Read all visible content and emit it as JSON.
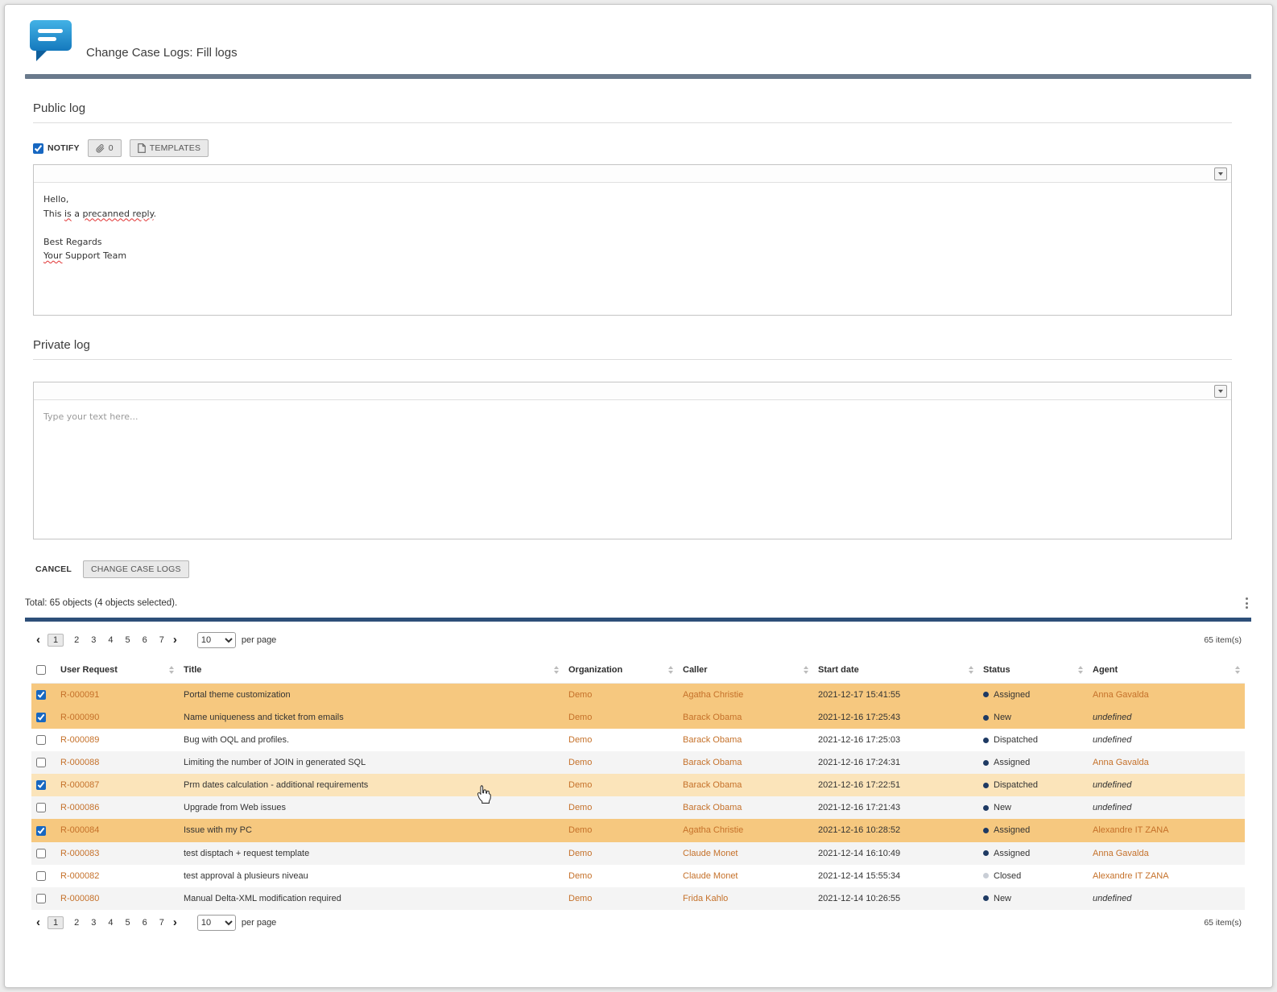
{
  "window": {
    "title": "Change Case Logs: Fill logs"
  },
  "public_log": {
    "heading": "Public log",
    "notify_label": "NOTIFY",
    "attach_count": "0",
    "templates_label": "TEMPLATES",
    "lines": [
      "Hello,",
      [
        {
          "t": "This "
        },
        {
          "t": "is",
          "m": true
        },
        {
          "t": " a "
        },
        {
          "t": "precanned reply",
          "m": true
        },
        {
          "t": "."
        }
      ],
      "",
      "Best Regards",
      [
        {
          "t": "Your",
          "m": true
        },
        {
          "t": " Support Team"
        }
      ]
    ]
  },
  "private_log": {
    "heading": "Private log",
    "placeholder": "Type your text here..."
  },
  "actions": {
    "cancel": "CANCEL",
    "submit": "CHANGE CASE LOGS"
  },
  "results": {
    "summary": "Total: 65 objects (4 objects selected).",
    "items_count": "65 item(s)",
    "per_page_value": "10",
    "per_page_label": "per page",
    "current_page": "1",
    "pages": [
      "1",
      "2",
      "3",
      "4",
      "5",
      "6",
      "7"
    ],
    "prev_arrow": "‹",
    "next_arrow": "›",
    "columns": [
      "User Request",
      "Title",
      "Organization",
      "Caller",
      "Start date",
      "Status",
      "Agent"
    ],
    "rows": [
      {
        "id": "R-000091",
        "title": "Portal theme customization",
        "org": "Demo",
        "caller": "Agatha Christie",
        "start": "2021-12-17 15:41:55",
        "status": "Assigned",
        "agent": "Anna Gavalda",
        "selected": true
      },
      {
        "id": "R-000090",
        "title": "Name uniqueness and ticket from emails",
        "org": "Demo",
        "caller": "Barack Obama",
        "start": "2021-12-16 17:25:43",
        "status": "New",
        "agent": "undefined",
        "selected": true
      },
      {
        "id": "R-000089",
        "title": "Bug with OQL and profiles.",
        "org": "Demo",
        "caller": "Barack Obama",
        "start": "2021-12-16 17:25:03",
        "status": "Dispatched",
        "agent": "undefined",
        "selected": false
      },
      {
        "id": "R-000088",
        "title": "Limiting the number of JOIN in generated SQL",
        "org": "Demo",
        "caller": "Barack Obama",
        "start": "2021-12-16 17:24:31",
        "status": "Assigned",
        "agent": "Anna Gavalda",
        "selected": false
      },
      {
        "id": "R-000087",
        "title": "Prm dates calculation - additional requirements",
        "org": "Demo",
        "caller": "Barack Obama",
        "start": "2021-12-16 17:22:51",
        "status": "Dispatched",
        "agent": "undefined",
        "selected": true,
        "hovered": true
      },
      {
        "id": "R-000086",
        "title": "Upgrade from Web issues",
        "org": "Demo",
        "caller": "Barack Obama",
        "start": "2021-12-16 17:21:43",
        "status": "New",
        "agent": "undefined",
        "selected": false
      },
      {
        "id": "R-000084",
        "title": "Issue with my PC",
        "org": "Demo",
        "caller": "Agatha Christie",
        "start": "2021-12-16 10:28:52",
        "status": "Assigned",
        "agent": "Alexandre IT ZANA",
        "selected": true
      },
      {
        "id": "R-000083",
        "title": "test disptach + request template",
        "org": "Demo",
        "caller": "Claude Monet",
        "start": "2021-12-14 16:10:49",
        "status": "Assigned",
        "agent": "Anna Gavalda",
        "selected": false
      },
      {
        "id": "R-000082",
        "title": "test approval à plusieurs niveau",
        "org": "Demo",
        "caller": "Claude Monet",
        "start": "2021-12-14 15:55:34",
        "status": "Closed",
        "agent": "Alexandre IT ZANA",
        "selected": false
      },
      {
        "id": "R-000080",
        "title": "Manual Delta-XML modification required",
        "org": "Demo",
        "caller": "Frida Kahlo",
        "start": "2021-12-14 10:26:55",
        "status": "New",
        "agent": "undefined",
        "selected": false
      }
    ]
  },
  "colors": {
    "accent_blue": "#1767c1",
    "link_orange": "#c5712a",
    "row_selected": "#f6c87f",
    "row_selected_hover": "#fbe4ba",
    "status_dot": "#1e3a63",
    "status_dot_closed": "#c9ced6",
    "header_bar": "#6a7a8c",
    "panel_bar": "#2d4f79"
  }
}
